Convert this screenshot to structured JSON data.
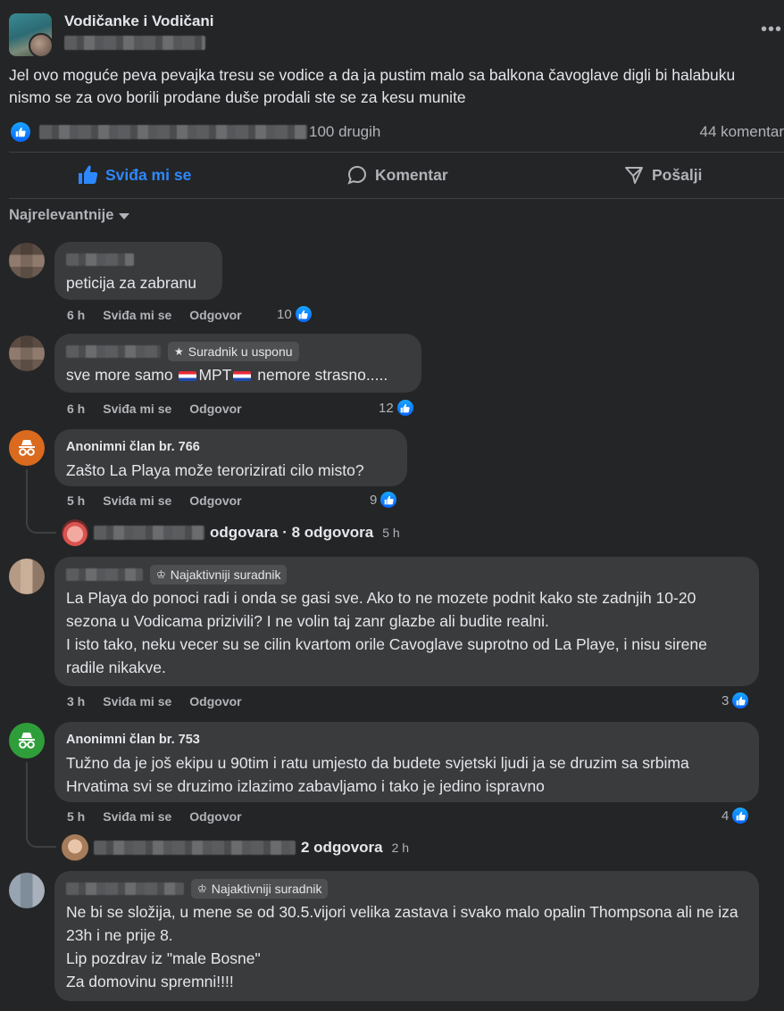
{
  "post": {
    "group_name": "Vodičanke i Vodičani",
    "text": "Jel ovo moguće peva pevajka tresu se vodice a da ja pustim malo sa balkona čavoglave digli bi halabuku nismo se za ovo borili prodane duše prodali ste se za kesu munite",
    "reactions_suffix": "100 drugih",
    "comments_count": "44 komentar",
    "more_icon": "•••"
  },
  "actions": {
    "like": "Sviđa mi se",
    "comment": "Komentar",
    "share": "Pošalji"
  },
  "sort_label": "Najrelevantnije",
  "comment_actions": {
    "like": "Sviđa mi se",
    "reply": "Odgovor"
  },
  "comments": [
    {
      "author": "",
      "badge": "",
      "text": "peticija za zabranu",
      "time": "6 h",
      "reactions": "10"
    },
    {
      "author": "",
      "badge": "Suradnik u usponu",
      "text_before": "sve more samo ",
      "text_mid": "MPT",
      "text_after": " nemore strasno.....",
      "time": "6 h",
      "reactions": "12"
    },
    {
      "author": "Anonimni član br. 766",
      "badge": "",
      "text": "Zašto La Playa može terorizirati cilo misto?",
      "time": "5 h",
      "reactions": "9",
      "replies_text": "odgovara · 8 odgovora",
      "replies_time": "5 h",
      "avatar_color": "#d96a1e"
    },
    {
      "author": "",
      "badge": "Najaktivniji suradnik",
      "text": "La Playa do ponoci radi i onda se gasi sve. Ako to ne mozete podnit kako ste zadnjih 10-20 sezona u Vodicama prizivili? I ne volin taj zanr glazbe ali budite realni.\nI isto tako, neku vecer su se cilin kvartom orile Cavoglave suprotno od La Playe, i nisu sirene radile nikakve.",
      "time": "3 h",
      "reactions": "3"
    },
    {
      "author": "Anonimni član br. 753",
      "badge": "",
      "text": "Tužno da je još ekipu u 90tim i ratu umjesto da budete svjetski ljudi ja se druzim sa srbima Hrvatima svi se druzimo izlazimo zabavljamo i tako je jedino ispravno",
      "time": "5 h",
      "reactions": "4",
      "replies_text": "2 odgovora",
      "replies_time": "2 h",
      "avatar_color": "#2f9e3a"
    },
    {
      "author": "",
      "badge": "Najaktivniji suradnik",
      "text": "Ne bi se složija, u mene se od 30.5.vijori velika zastava i svako malo opalin Thompsona ali ne iza 23h i ne prije 8.\nLip pozdrav iz \"male Bosne\"\nZa domovinu spremni!!!!"
    }
  ],
  "colors": {
    "background": "#242526",
    "bubble": "#3a3b3c",
    "accent_blue": "#2d88ff",
    "text_primary": "#e4e6eb",
    "text_secondary": "#b0b3b8"
  }
}
